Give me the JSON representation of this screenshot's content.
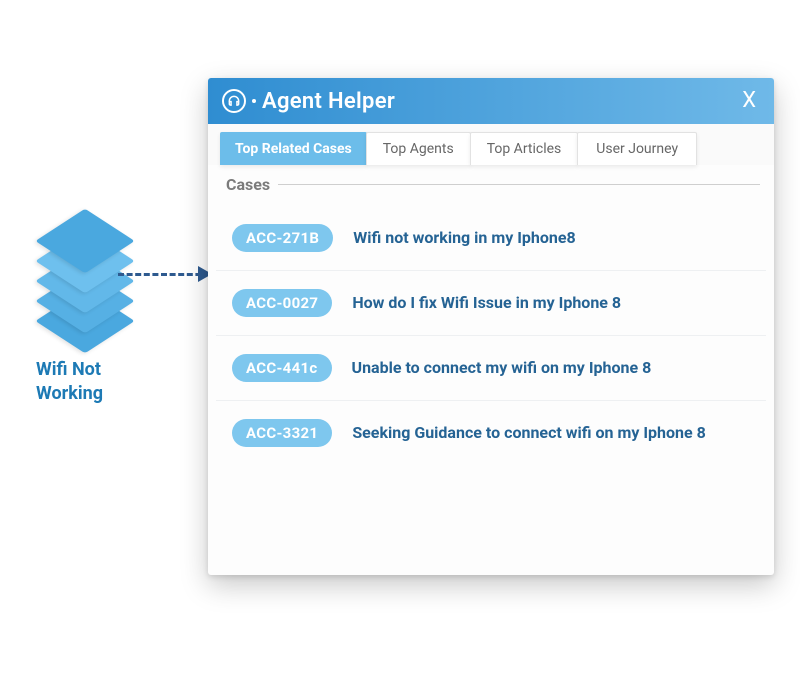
{
  "left": {
    "label_line1": "Wifi Not",
    "label_line2": "Working"
  },
  "panel": {
    "title": "Agent Helper",
    "close_label": "X",
    "tabs": [
      {
        "label": "Top Related Cases",
        "active": true
      },
      {
        "label": "Top Agents",
        "active": false
      },
      {
        "label": "Top Articles",
        "active": false
      },
      {
        "label": "User Journey",
        "active": false
      }
    ],
    "section_label": "Cases",
    "cases": [
      {
        "id": "ACC-271B",
        "title": "Wifi not working in my Iphone8"
      },
      {
        "id": "ACC-0027",
        "title": "How do I fix Wifi Issue in my Iphone 8"
      },
      {
        "id": "ACC-441c",
        "title": "Unable to connect my wifi on my Iphone 8"
      },
      {
        "id": "ACC-3321",
        "title": "Seeking Guidance to connect wifi on my Iphone 8"
      }
    ]
  }
}
